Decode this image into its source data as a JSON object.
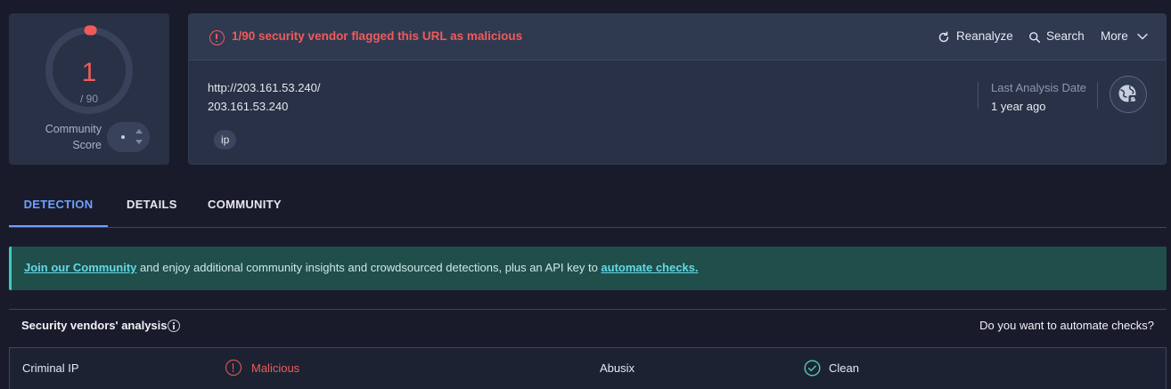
{
  "score": {
    "detections": "1",
    "total": "/ 90",
    "detected_fraction": 0.0111,
    "community_label_line1": "Community",
    "community_label_line2": "Score"
  },
  "alert": {
    "text": "1/90 security vendor flagged this URL as malicious",
    "icon": "alert-circle-icon",
    "color": "#ef5b5b"
  },
  "actions": {
    "reanalyze": "Reanalyze",
    "search": "Search",
    "more": "More"
  },
  "target": {
    "url": "http://203.161.53.240/",
    "host": "203.161.53.240",
    "tag": "ip"
  },
  "analysis": {
    "label": "Last Analysis Date",
    "value": "1 year ago"
  },
  "tabs": [
    {
      "label": "DETECTION",
      "active": true
    },
    {
      "label": "DETAILS",
      "active": false
    },
    {
      "label": "COMMUNITY",
      "active": false
    }
  ],
  "banner": {
    "link1": "Join our Community",
    "middle": " and enjoy additional community insights and crowdsourced detections, plus an API key to ",
    "link2": "automate checks."
  },
  "vendors": {
    "title": "Security vendors' analysis",
    "automate_prompt": "Do you want to automate checks?",
    "rows": [
      {
        "name": "Criminal IP",
        "result": "Malicious",
        "status": "malicious"
      },
      {
        "name": "Abusix",
        "result": "Clean",
        "status": "clean"
      }
    ]
  },
  "colors": {
    "accent": "#6fa0ff",
    "malicious": "#ef5b5b",
    "clean": "#4fc3a1",
    "banner": "#1f4e4b"
  }
}
